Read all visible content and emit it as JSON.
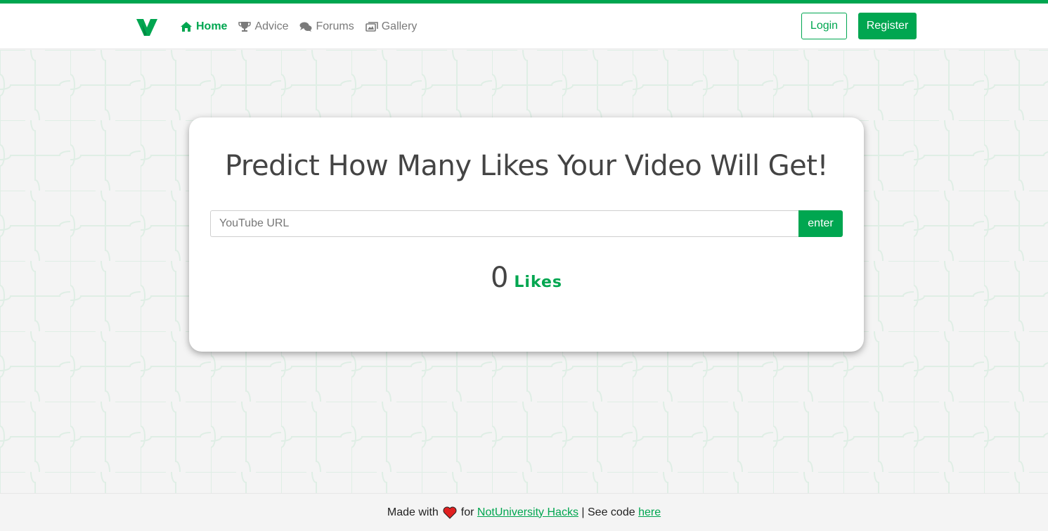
{
  "colors": {
    "brand": "#00a650",
    "text": "#444444",
    "background": "#f4f4f4"
  },
  "nav": {
    "logo_icon": "brand-v-logo",
    "links": [
      {
        "label": "Home",
        "icon": "home-icon",
        "active": true
      },
      {
        "label": "Advice",
        "icon": "trophy-icon",
        "active": false
      },
      {
        "label": "Forums",
        "icon": "comments-icon",
        "active": false
      },
      {
        "label": "Gallery",
        "icon": "images-icon",
        "active": false
      }
    ],
    "login_label": "Login",
    "register_label": "Register"
  },
  "main": {
    "title": "Predict How Many Likes Your Video Will Get!",
    "url_input": {
      "placeholder": "YouTube URL",
      "value": ""
    },
    "enter_label": "enter",
    "result_count": "0",
    "result_unit": "Likes"
  },
  "footer": {
    "made_with": "Made with",
    "heart_icon": "heart-icon",
    "for_text": "for",
    "hackathon_link": "NotUniversity Hacks",
    "separator": "| See code",
    "code_link": "here"
  }
}
